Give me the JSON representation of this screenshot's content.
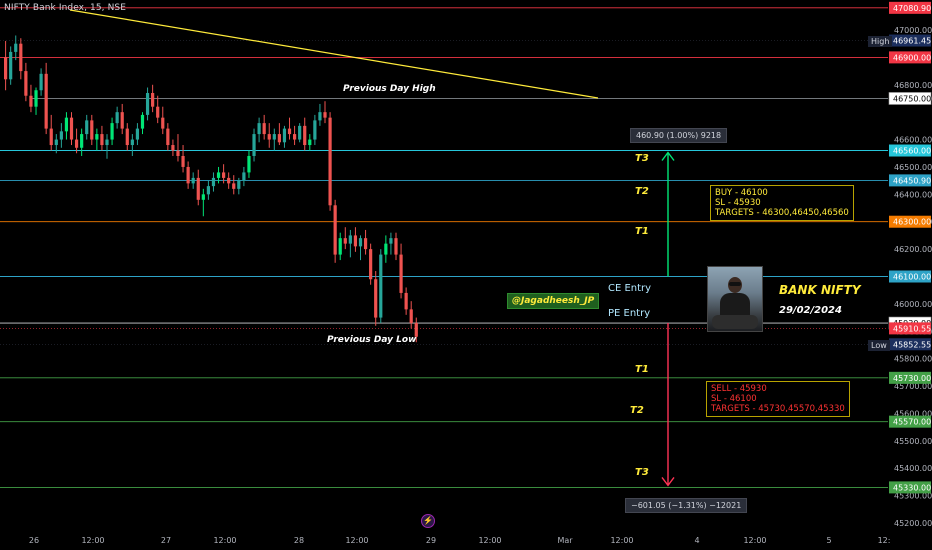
{
  "chart_title": "NIFTY Bank Index, 15, NSE",
  "chart_data": {
    "type": "candlestick",
    "y_range": [
      45150,
      47140
    ],
    "y_ticks": [
      47000,
      46800,
      46750,
      46600,
      46500,
      46400,
      46300,
      46200,
      46000,
      45900,
      45800,
      45700,
      45600,
      45500,
      45400,
      45300,
      45200
    ],
    "x_ticks": [
      "26",
      "12:00",
      "27",
      "12:00",
      "28",
      "12:00",
      "29",
      "12:00",
      "Mar",
      "12:00",
      "4",
      "12:00",
      "5",
      "12:"
    ],
    "series": [
      {
        "values": [
          [
            46900,
            46960,
            46780,
            46820
          ],
          [
            46820,
            46940,
            46800,
            46920
          ],
          [
            46920,
            46980,
            46890,
            46950
          ],
          [
            46950,
            46970,
            46820,
            46850
          ],
          [
            46850,
            46880,
            46740,
            46760
          ],
          [
            46760,
            46800,
            46700,
            46720
          ],
          [
            46720,
            46790,
            46690,
            46780
          ],
          [
            46780,
            46860,
            46760,
            46840
          ],
          [
            46840,
            46880,
            46620,
            46640
          ],
          [
            46640,
            46690,
            46560,
            46580
          ],
          [
            46580,
            46620,
            46550,
            46600
          ],
          [
            46600,
            46660,
            46570,
            46630
          ],
          [
            46630,
            46700,
            46600,
            46680
          ],
          [
            46680,
            46700,
            46580,
            46600
          ],
          [
            46600,
            46640,
            46550,
            46570
          ],
          [
            46570,
            46640,
            46540,
            46620
          ],
          [
            46620,
            46690,
            46600,
            46670
          ],
          [
            46670,
            46690,
            46580,
            46600
          ],
          [
            46600,
            46640,
            46560,
            46620
          ],
          [
            46620,
            46650,
            46560,
            46580
          ],
          [
            46580,
            46620,
            46530,
            46600
          ],
          [
            46600,
            46680,
            46580,
            46660
          ],
          [
            46660,
            46720,
            46640,
            46700
          ],
          [
            46700,
            46730,
            46620,
            46640
          ],
          [
            46640,
            46660,
            46560,
            46580
          ],
          [
            46580,
            46620,
            46540,
            46600
          ],
          [
            46600,
            46660,
            46580,
            46640
          ],
          [
            46640,
            46700,
            46620,
            46690
          ],
          [
            46690,
            46790,
            46670,
            46770
          ],
          [
            46770,
            46800,
            46700,
            46720
          ],
          [
            46720,
            46760,
            46660,
            46680
          ],
          [
            46680,
            46720,
            46620,
            46640
          ],
          [
            46640,
            46660,
            46560,
            46580
          ],
          [
            46580,
            46600,
            46540,
            46560
          ],
          [
            46560,
            46620,
            46520,
            46540
          ],
          [
            46540,
            46580,
            46480,
            46500
          ],
          [
            46500,
            46520,
            46420,
            46440
          ],
          [
            46440,
            46480,
            46420,
            46460
          ],
          [
            46460,
            46490,
            46360,
            46380
          ],
          [
            46380,
            46420,
            46320,
            46400
          ],
          [
            46400,
            46450,
            46380,
            46430
          ],
          [
            46430,
            46480,
            46410,
            46460
          ],
          [
            46460,
            46500,
            46440,
            46480
          ],
          [
            46480,
            46510,
            46440,
            46460
          ],
          [
            46460,
            46480,
            46420,
            46440
          ],
          [
            46440,
            46470,
            46400,
            46420
          ],
          [
            46420,
            46460,
            46400,
            46450
          ],
          [
            46450,
            46500,
            46430,
            46480
          ],
          [
            46480,
            46560,
            46460,
            46540
          ],
          [
            46540,
            46640,
            46520,
            46620
          ],
          [
            46620,
            46680,
            46590,
            46660
          ],
          [
            46660,
            46690,
            46600,
            46620
          ],
          [
            46620,
            46660,
            46570,
            46600
          ],
          [
            46600,
            46640,
            46560,
            46620
          ],
          [
            46620,
            46660,
            46580,
            46590
          ],
          [
            46590,
            46650,
            46570,
            46640
          ],
          [
            46640,
            46680,
            46600,
            46620
          ],
          [
            46620,
            46650,
            46580,
            46600
          ],
          [
            46600,
            46660,
            46590,
            46650
          ],
          [
            46650,
            46680,
            46560,
            46580
          ],
          [
            46580,
            46620,
            46560,
            46600
          ],
          [
            46600,
            46690,
            46580,
            46670
          ],
          [
            46670,
            46730,
            46650,
            46700
          ],
          [
            46700,
            46740,
            46660,
            46680
          ],
          [
            46680,
            46700,
            46340,
            46360
          ],
          [
            46360,
            46380,
            46150,
            46180
          ],
          [
            46180,
            46260,
            46160,
            46240
          ],
          [
            46240,
            46280,
            46200,
            46220
          ],
          [
            46220,
            46270,
            46170,
            46250
          ],
          [
            46250,
            46280,
            46190,
            46210
          ],
          [
            46210,
            46250,
            46160,
            46240
          ],
          [
            46240,
            46270,
            46180,
            46200
          ],
          [
            46200,
            46220,
            46070,
            46090
          ],
          [
            46090,
            46120,
            45920,
            45950
          ],
          [
            45950,
            46200,
            45930,
            46180
          ],
          [
            46180,
            46250,
            46150,
            46220
          ],
          [
            46220,
            46260,
            46180,
            46240
          ],
          [
            46240,
            46260,
            46160,
            46180
          ],
          [
            46180,
            46220,
            46020,
            46040
          ],
          [
            46040,
            46060,
            45960,
            45980
          ],
          [
            45980,
            46010,
            45910,
            45930
          ],
          [
            45930,
            45950,
            45860,
            45880
          ]
        ]
      }
    ],
    "annotations": {
      "previous_day_high": "Previous Day High",
      "previous_day_low": "Previous Day Low",
      "ce_entry": "CE Entry",
      "pe_entry": "PE Entry",
      "t_up": [
        "T3",
        "T2",
        "T1"
      ],
      "t_down": [
        "T1",
        "T2",
        "T3"
      ],
      "handle": "@Jagadheesh_JP",
      "buy_box": [
        "BUY - 46100",
        "SL - 45930",
        "TARGETS - 46300,46450,46560"
      ],
      "sell_box": [
        "SELL - 45930",
        "SL - 46100",
        "TARGETS - 45730,45570,45330"
      ],
      "up_measure": "460.90 (1.00%) 9218",
      "down_measure": "−601.05 (−1.31%) −12021",
      "card_title": "BANK NIFTY",
      "card_date": "29/02/2024",
      "high_label": "High",
      "low_label": "Low"
    },
    "levels": [
      {
        "value": 47080.9,
        "label": "47080.90",
        "color": "#f23645"
      },
      {
        "value": 46961.45,
        "label": "46961.45",
        "color": "#1c2f5e"
      },
      {
        "value": 46900.0,
        "label": "46900.00",
        "color": "#f23645"
      },
      {
        "value": 46750.0,
        "label": "46750.00",
        "color": "#ffffff"
      },
      {
        "value": 46560.0,
        "label": "46560.00",
        "color": "#26c6da"
      },
      {
        "value": 46450.9,
        "label": "46450.90",
        "color": "#2ea3c7"
      },
      {
        "value": 46300.0,
        "label": "46300.00",
        "color": "#f57c00"
      },
      {
        "value": 46100.0,
        "label": "46100.00",
        "color": "#2ea3c7"
      },
      {
        "value": 45930.0,
        "label": "45930.00",
        "color": "#ffffff"
      },
      {
        "value": 45910.55,
        "label": "45910.55",
        "color": "#f23645"
      },
      {
        "value": 45852.55,
        "label": "45852.55",
        "color": "#1c2f5e"
      },
      {
        "value": 45730.0,
        "label": "45730.00",
        "color": "#43a047"
      },
      {
        "value": 45570.0,
        "label": "45570.00",
        "color": "#43a047"
      },
      {
        "value": 45330.0,
        "label": "45330.00",
        "color": "#43a047"
      }
    ],
    "colors": {
      "up": "#26a69a",
      "up_bright": "#00e676",
      "down": "#ef5350",
      "trend": "#ffeb3b",
      "buy_arrow": "#00e676",
      "sell_arrow": "#ff3355"
    }
  }
}
